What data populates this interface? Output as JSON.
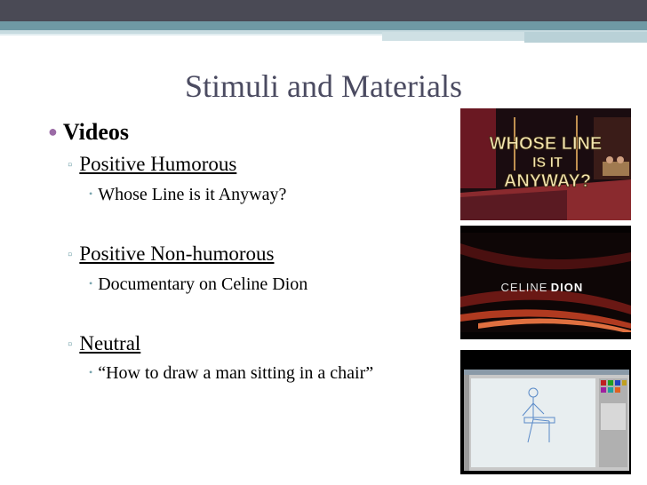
{
  "slide": {
    "title": "Stimuli and Materials",
    "bullets": {
      "videos": "Videos",
      "positive_humorous": "Positive Humorous",
      "whose_line": "Whose Line is it Anyway?",
      "positive_nonhumorous": "Positive Non-humorous",
      "celine_doc": "Documentary on Celine Dion",
      "neutral": "Neutral",
      "draw_man": "“How to draw a man sitting in a chair”"
    },
    "thumbnails": {
      "whose_line": {
        "line1": "WHOSE LINE",
        "line2": "IS IT",
        "line3": "ANYWAY?"
      },
      "celine": {
        "name_light": "CELINE",
        "name_bold": "DION"
      }
    }
  },
  "colors": {
    "title": "#4b4b61",
    "band_dark": "#4a4a55",
    "band_teal": "#6f99a4",
    "bullet_purple": "#9b6ba6",
    "bullet_teal": "#7aa5ae"
  }
}
